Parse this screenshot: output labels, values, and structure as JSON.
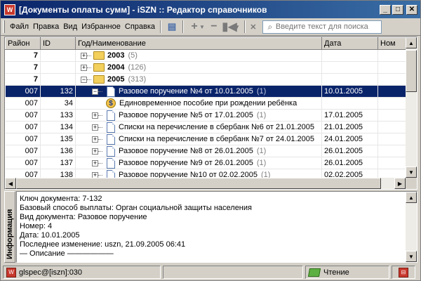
{
  "window": {
    "title": "[Документы оплаты сумм] - iSZN :: Редактор справочников",
    "app_icon": "iSZN-app-icon",
    "controls": [
      "minimize-icon",
      "maximize-icon",
      "close-icon"
    ]
  },
  "menu": {
    "items": [
      "Файл",
      "Правка",
      "Вид",
      "Избранное",
      "Справка"
    ]
  },
  "toolbar": {
    "search_placeholder": "Введите текст для поиска"
  },
  "grid": {
    "columns": [
      "Район",
      "ID",
      "Год/Наименование",
      "Дата",
      "Ном"
    ],
    "rows": [
      {
        "rayon": "7",
        "id": "",
        "name": "2003",
        "count": "(5)",
        "date": "",
        "type": "year",
        "expander": "+"
      },
      {
        "rayon": "7",
        "id": "",
        "name": "2004",
        "count": "(126)",
        "date": "",
        "type": "year",
        "expander": "+"
      },
      {
        "rayon": "7",
        "id": "",
        "name": "2005",
        "count": "(313)",
        "date": "",
        "type": "year",
        "expander": "−"
      },
      {
        "rayon": "007",
        "id": "132",
        "name": "Разовое поручение №4 от 10.01.2005",
        "count": "(1)",
        "date": "10.01.2005",
        "type": "doc",
        "expander": "−",
        "selected": true
      },
      {
        "rayon": "007",
        "id": "34",
        "name": "Единовременное пособие при рождении ребёнка",
        "count": "",
        "date": "",
        "type": "pay"
      },
      {
        "rayon": "007",
        "id": "133",
        "name": "Разовое поручение №5 от 17.01.2005",
        "count": "(1)",
        "date": "17.01.2005",
        "type": "doc",
        "expander": "+"
      },
      {
        "rayon": "007",
        "id": "134",
        "name": "Списки на перечисление в сбербанк №6 от 21.01.2005",
        "count": "",
        "date": "21.01.2005",
        "type": "doc",
        "expander": "+"
      },
      {
        "rayon": "007",
        "id": "135",
        "name": "Списки на перечисление в сбербанк №7 от 24.01.2005",
        "count": "",
        "date": "24.01.2005",
        "type": "doc",
        "expander": "+"
      },
      {
        "rayon": "007",
        "id": "136",
        "name": "Разовое поручение №8 от 26.01.2005",
        "count": "(1)",
        "date": "26.01.2005",
        "type": "doc",
        "expander": "+"
      },
      {
        "rayon": "007",
        "id": "137",
        "name": "Разовое поручение №9 от 26.01.2005",
        "count": "(1)",
        "date": "26.01.2005",
        "type": "doc",
        "expander": "+"
      },
      {
        "rayon": "007",
        "id": "138",
        "name": "Разовое поручение №10 от 02.02.2005",
        "count": "(1)",
        "date": "02.02.2005",
        "type": "doc",
        "expander": "+"
      }
    ]
  },
  "info": {
    "tab_label": "Информация",
    "lines": [
      "Ключ документа: 7-132",
      "Базовый способ выплаты: Орган социальной защиты населения",
      "Вид документа: Разовое поручение",
      "Номер: 4",
      "Дата: 10.01.2005",
      "Последнее изменение: uszn, 21.09.2005 06:41",
      "— Описание ——————"
    ]
  },
  "status": {
    "user": "glspec@[iszn]:030",
    "mode": "Чтение"
  }
}
